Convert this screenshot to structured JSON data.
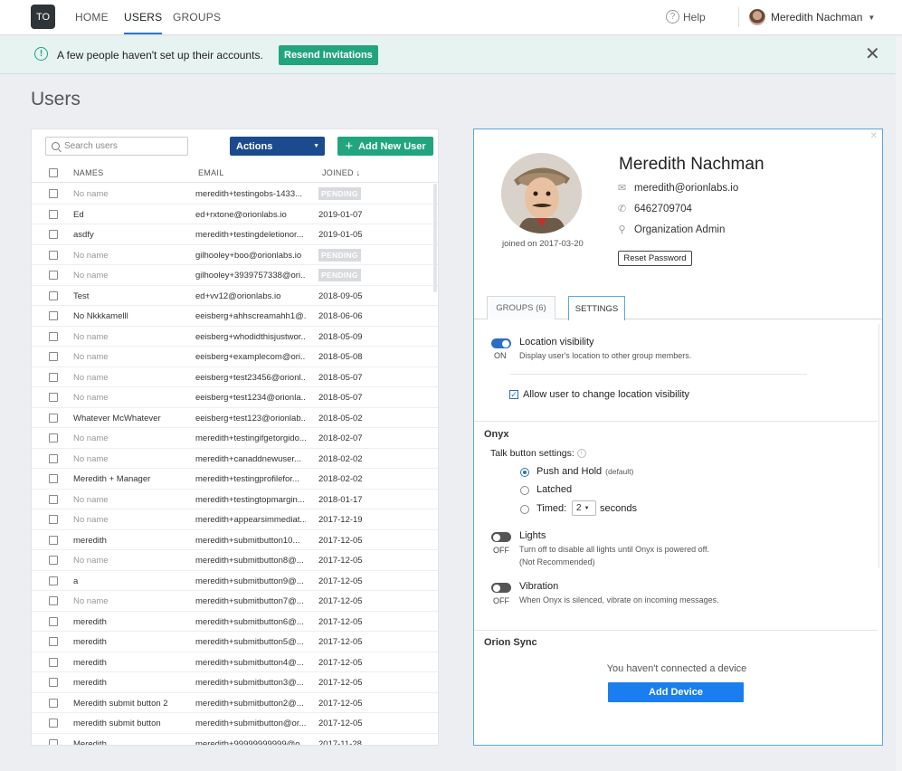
{
  "nav": {
    "logo": "TO",
    "links": [
      "HOME",
      "USERS",
      "GROUPS"
    ],
    "help": "Help",
    "user": "Meredith Nachman"
  },
  "banner": {
    "text": "A few people haven't set up their accounts.",
    "button": "Resend Invitations"
  },
  "page_title": "Users",
  "users_panel": {
    "search_placeholder": "Search users",
    "actions_label": "Actions",
    "add_user_label": "Add New User",
    "columns": [
      "NAMES",
      "EMAIL",
      "JOINED ↓"
    ],
    "rows": [
      {
        "name": "No name",
        "email": "meredith+testingobs-1433...",
        "joined": "PENDING"
      },
      {
        "name": "Ed",
        "email": "ed+rxtone@orionlabs.io",
        "joined": "2019-01-07"
      },
      {
        "name": "asdfy",
        "email": "meredith+testingdeletionor...",
        "joined": "2019-01-05"
      },
      {
        "name": "No name",
        "email": "gilhooley+boo@orionlabs.io",
        "joined": "PENDING"
      },
      {
        "name": "No name",
        "email": "gilhooley+3939757338@ori...",
        "joined": "PENDING"
      },
      {
        "name": "Test",
        "email": "ed+vv12@orionlabs.io",
        "joined": "2018-09-05"
      },
      {
        "name": "No Nkkkamelll",
        "email": "eeisberg+ahhscreamahh1@...",
        "joined": "2018-06-06"
      },
      {
        "name": "No name",
        "email": "eeisberg+whodidthisjustwor...",
        "joined": "2018-05-09"
      },
      {
        "name": "No name",
        "email": "eeisberg+examplecom@ori...",
        "joined": "2018-05-08"
      },
      {
        "name": "No name",
        "email": "eeisberg+test23456@orionl...",
        "joined": "2018-05-07"
      },
      {
        "name": "No name",
        "email": "eeisberg+test1234@orionla...",
        "joined": "2018-05-07"
      },
      {
        "name": "Whatever McWhatever",
        "email": "eeisberg+test123@orionlab...",
        "joined": "2018-05-02"
      },
      {
        "name": "No name",
        "email": "meredith+testingifgetorgido...",
        "joined": "2018-02-07"
      },
      {
        "name": "No name",
        "email": "meredith+canaddnewuser...",
        "joined": "2018-02-02"
      },
      {
        "name": "Meredith + Manager",
        "email": "meredith+testingprofilefor...",
        "joined": "2018-02-02"
      },
      {
        "name": "No name",
        "email": "meredith+testingtopmargin...",
        "joined": "2018-01-17"
      },
      {
        "name": "No name",
        "email": "meredith+appearsimmediat...",
        "joined": "2017-12-19"
      },
      {
        "name": "meredith",
        "email": "meredith+submitbutton10...",
        "joined": "2017-12-05"
      },
      {
        "name": "No name",
        "email": "meredith+submitbutton8@...",
        "joined": "2017-12-05"
      },
      {
        "name": "a",
        "email": "meredith+submitbutton9@...",
        "joined": "2017-12-05"
      },
      {
        "name": "No name",
        "email": "meredith+submitbutton7@...",
        "joined": "2017-12-05"
      },
      {
        "name": "meredith",
        "email": "meredith+submitbutton6@...",
        "joined": "2017-12-05"
      },
      {
        "name": "meredith",
        "email": "meredith+submitbutton5@...",
        "joined": "2017-12-05"
      },
      {
        "name": "meredith",
        "email": "meredith+submitbutton4@...",
        "joined": "2017-12-05"
      },
      {
        "name": "meredith",
        "email": "meredith+submitbutton3@...",
        "joined": "2017-12-05"
      },
      {
        "name": "Meredith submit button 2",
        "email": "meredith+submitbutton2@...",
        "joined": "2017-12-05"
      },
      {
        "name": "meredith submit button",
        "email": "meredith+submitbutton@or...",
        "joined": "2017-12-05"
      },
      {
        "name": "Meredith",
        "email": "meredith+99999999999@o...",
        "joined": "2017-11-28"
      }
    ]
  },
  "profile": {
    "name": "Meredith Nachman",
    "email": "meredith@orionlabs.io",
    "phone": "6462709704",
    "role": "Organization Admin",
    "joined": "joined on 2017-03-20",
    "reset_password": "Reset Password",
    "tabs": [
      "GROUPS (6)",
      "SETTINGS"
    ]
  },
  "settings": {
    "location": {
      "title": "Location visibility",
      "state": "ON",
      "desc": "Display user's location to other group members.",
      "allow_change": "Allow user to change location visibility"
    },
    "onyx": {
      "title": "Onyx",
      "talk_label": "Talk button settings:",
      "options": [
        "Push and Hold",
        "Latched",
        "Timed:"
      ],
      "default_hint": "(default)",
      "timed_value": "2",
      "seconds": "seconds",
      "lights_title": "Lights",
      "lights_state": "OFF",
      "lights_desc": "Turn off to disable all lights until Onyx is powered off.",
      "lights_note": "(Not Recommended)",
      "vibration_title": "Vibration",
      "vibration_state": "OFF",
      "vibration_desc": "When Onyx is silenced, vibrate on incoming messages."
    },
    "sync": {
      "title": "Orion Sync",
      "no_device": "You haven't connected a device",
      "add_device": "Add Device"
    }
  }
}
